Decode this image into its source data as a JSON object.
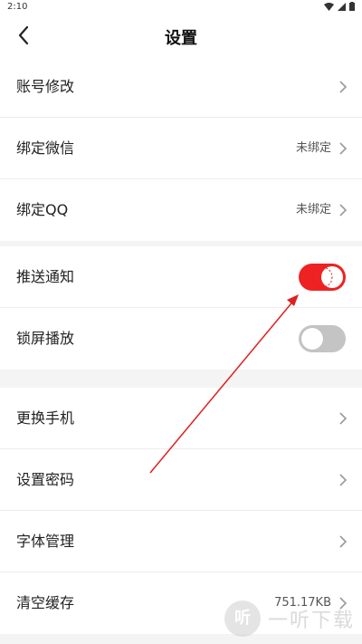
{
  "status_bar": {
    "time": "2:10"
  },
  "navbar": {
    "title": "设置"
  },
  "groups": [
    {
      "items": [
        {
          "label": "账号修改",
          "value": ""
        },
        {
          "label": "绑定微信",
          "value": "未绑定"
        },
        {
          "label": "绑定QQ",
          "value": "未绑定"
        }
      ]
    },
    {
      "items": [
        {
          "label": "推送通知",
          "toggle_on": true
        },
        {
          "label": "锁屏播放",
          "toggle_on": false
        }
      ]
    },
    {
      "items": [
        {
          "label": "更换手机",
          "value": ""
        },
        {
          "label": "设置密码",
          "value": ""
        },
        {
          "label": "字体管理",
          "value": ""
        },
        {
          "label": "清空缓存",
          "value": "751.17KB"
        }
      ]
    }
  ],
  "watermark": {
    "icon_text": "听",
    "text": "一听下载"
  },
  "colors": {
    "toggle_on": "#ee2222",
    "toggle_off": "#c4c4c4",
    "annotation_arrow": "#e02020"
  }
}
